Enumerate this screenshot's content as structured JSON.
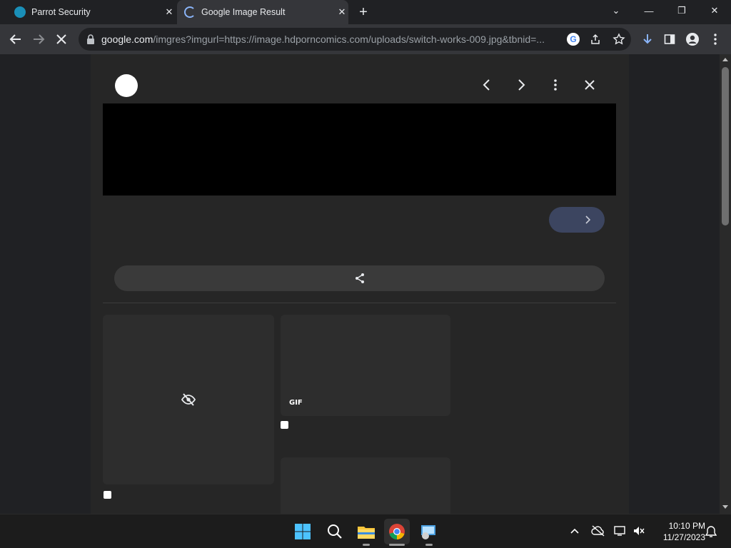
{
  "tabs": [
    {
      "title": "Parrot Security",
      "close": "✕"
    },
    {
      "title": "Google Image Result",
      "close": "✕"
    }
  ],
  "new_tab": "+",
  "window_controls": {
    "dropdown": "⌄",
    "minimize": "—",
    "restore": "❐",
    "close": "✕"
  },
  "toolbar": {
    "url_host": "google.com",
    "url_path": "/imgres?imgurl=https://image.hdporncomics.com/uploads/switch-works-009.jpg&tbnid=..."
  },
  "viewer": {
    "gif_badge": "GIF"
  },
  "taskbar": {
    "time": "10:10 PM",
    "date": "11/27/2023"
  },
  "colors": {
    "chrome_dark": "#202124",
    "toolbar": "#35363a",
    "panel": "#262626",
    "pill": "#3c4560"
  },
  "icons": {
    "back": "arrow-left-icon",
    "forward": "arrow-right-icon",
    "stop": "close-icon",
    "lock": "lock-icon",
    "google_lens": "google-icon",
    "share": "share-icon",
    "bookmark": "star-icon",
    "extensions": "download-icon",
    "sidepanel": "sidepanel-icon",
    "profile": "profile-icon",
    "menu": "kebab-icon"
  }
}
